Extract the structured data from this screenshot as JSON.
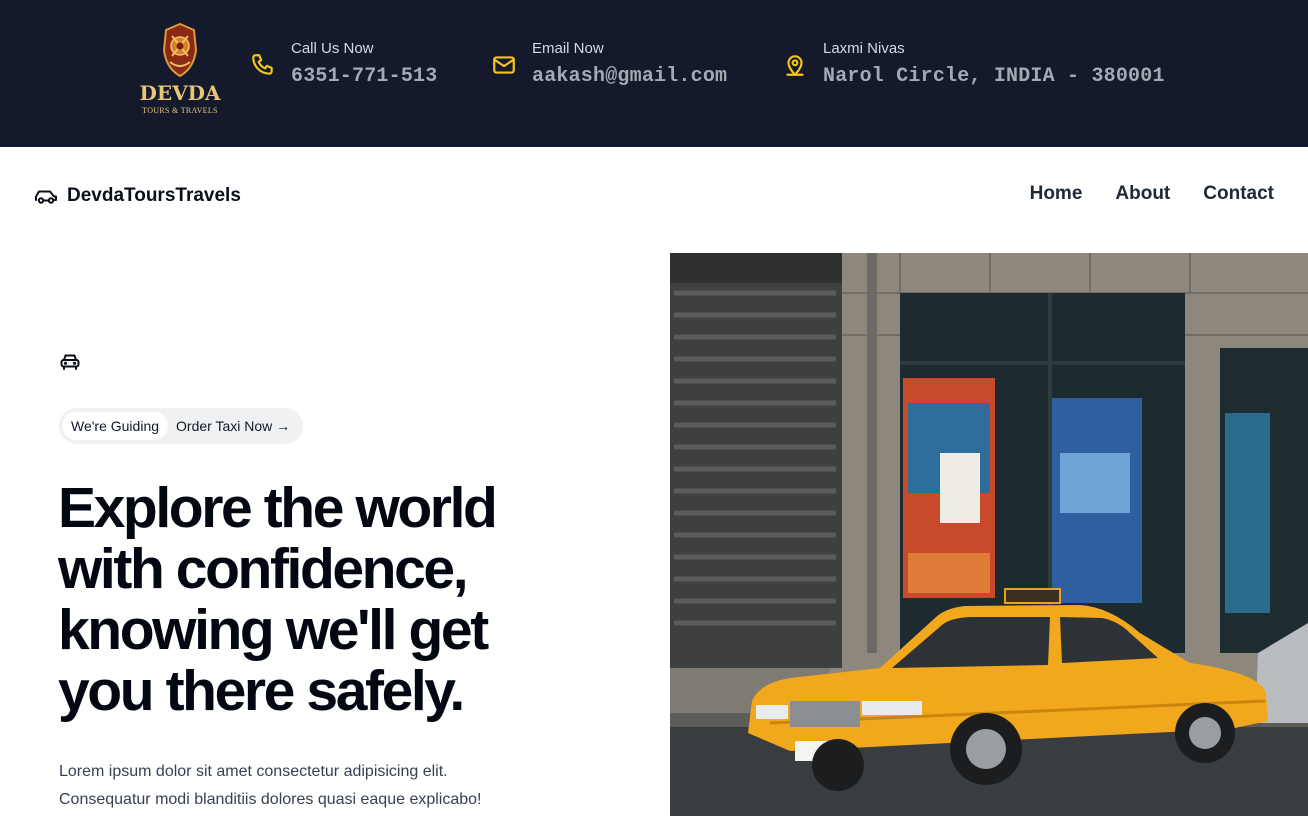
{
  "brand_colors": {
    "topbar_bg": "#141a2b",
    "accent_yellow": "#f5c518",
    "heading": "#030712",
    "taxi_yellow": "#f4a91a"
  },
  "logo": {
    "icon": "crest-logo-icon",
    "name": "DEVDA",
    "subtitle": "TOURS & TRAVELS"
  },
  "topbar": {
    "phone": {
      "icon": "phone-icon",
      "label": "Call Us Now",
      "value": "6351-771-513"
    },
    "email": {
      "icon": "mail-icon",
      "label": "Email Now",
      "value": "aakash@gmail.com"
    },
    "address": {
      "icon": "map-pin-icon",
      "label": "Laxmi Nivas",
      "value": "Narol Circle, INDIA - 380001"
    }
  },
  "navbar": {
    "brand_icon": "car-icon",
    "brand": "DevdaToursTravels",
    "links": [
      "Home",
      "About",
      "Contact"
    ]
  },
  "hero": {
    "icon": "taxi-icon",
    "badge": "We're Guiding",
    "cta": "Order Taxi Now →",
    "headline": [
      "Explore the world",
      "with confidence,",
      "knowing we'll get",
      "you there safely."
    ],
    "paragraph": [
      "Lorem ipsum dolor sit amet consectetur adipisicing elit.",
      "Consequatur modi blanditiis dolores quasi eaque explicabo!"
    ],
    "image": "yellow-taxi-photo"
  }
}
